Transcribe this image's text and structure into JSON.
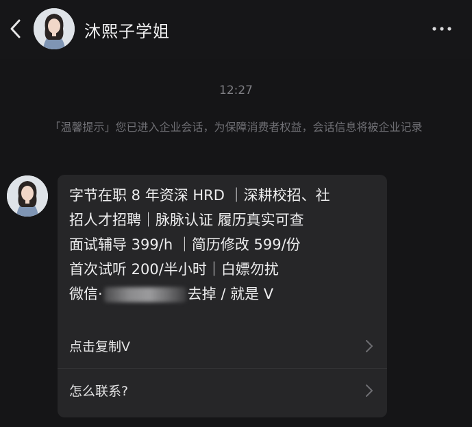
{
  "header": {
    "name": "沐熙子学姐",
    "back_icon": "chevron-left-icon",
    "more_icon": "more-dots-icon"
  },
  "chat": {
    "timestamp": "12:27",
    "notice": "「温馨提示」您已进入企业会话，为保障消费者权益，会话信息将被企业记录",
    "message": {
      "line1": "字节在职 8 年资深 HRD ｜深耕校招、社",
      "line2": "招人才招聘｜脉脉认证 履历真实可查",
      "line3": "面试辅导 399/h ｜简历修改 599/份",
      "line4": "首次试听 200/半小时｜白嫖勿扰",
      "line5_prefix": "微信·",
      "line5_suffix": "去掉 / 就是 V"
    },
    "actions": [
      {
        "label": "点击复制V"
      },
      {
        "label": "怎么联系?"
      }
    ]
  }
}
